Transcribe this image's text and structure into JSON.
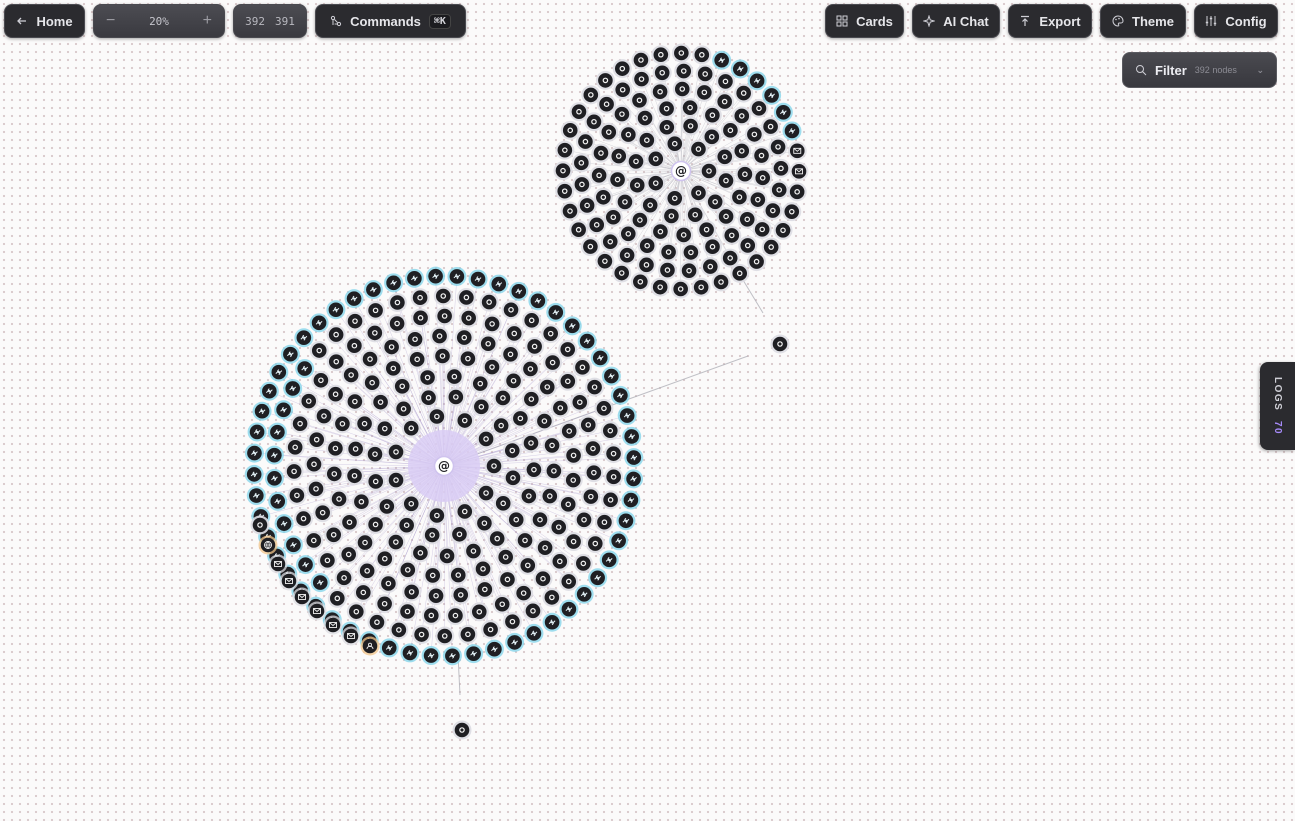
{
  "toolbar": {
    "home_label": "Home",
    "zoom_minus": "−",
    "zoom_value": "20%",
    "zoom_plus": "+",
    "node_count": "392",
    "edge_count": "391",
    "commands_label": "Commands",
    "commands_shortcut": "⌘K",
    "cards_label": "Cards",
    "ai_chat_label": "AI Chat",
    "export_label": "Export",
    "theme_label": "Theme",
    "config_label": "Config"
  },
  "filter": {
    "label": "Filter",
    "sub": "392 nodes",
    "chevron": "⌄"
  },
  "logs": {
    "label": "LOGS",
    "count": "70"
  },
  "graph": {
    "hub_glyph": "@",
    "node_glyph": "o",
    "accent": "#a78bfa",
    "link_ring_color": "#7fd3ea",
    "node_color": "#1f1f23",
    "hub_halo_color": "#d9ccf5",
    "icons": [
      "hub-icon",
      "node-icon",
      "link-icon",
      "mail-icon",
      "globe-icon",
      "person-icon"
    ]
  }
}
